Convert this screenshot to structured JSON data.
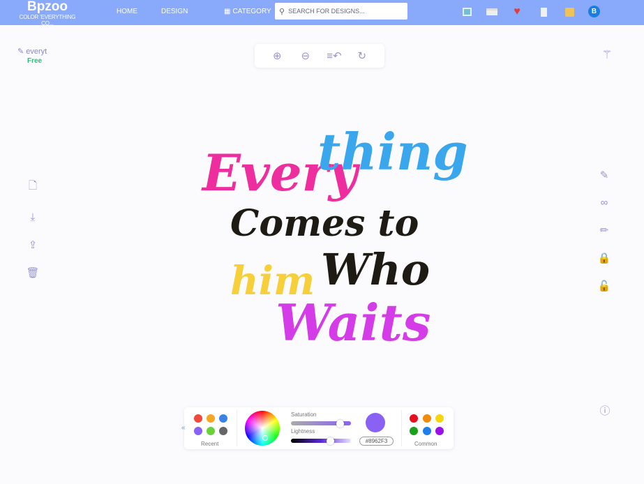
{
  "header": {
    "brand": "Bpzoo",
    "tagline": "COLOR 'EVERYTHING CO...",
    "nav": [
      "HOME",
      "DESIGN"
    ],
    "category": "CATEGORY",
    "search_placeholder": "SEARCH FOR DESIGNS...",
    "avatar": "B"
  },
  "design": {
    "title": "everyt",
    "price": "Free"
  },
  "artwork": {
    "lines": [
      "Every",
      "thing",
      "Comes to",
      "him",
      "Who",
      "Waits"
    ],
    "colors": [
      "#ee2e9f",
      "#3aa7ec",
      "#1e1a14",
      "#f6cf3b",
      "#1e1a14",
      "#d43ce8"
    ]
  },
  "palette": {
    "recent_label": "Recent",
    "common_label": "Common",
    "saturation_label": "Saturation",
    "lightness_label": "Lightness",
    "hex": "#8962F3",
    "saturation": 0.82,
    "lightness": 0.65,
    "recent": [
      "#f04a3a",
      "#f5a623",
      "#3b82e6",
      "#8962f3",
      "#6ad13b",
      "#666666"
    ],
    "common": [
      "#e8101f",
      "#f08c0a",
      "#f7d60e",
      "#1aa01d",
      "#1f7fe8",
      "#9b10e6"
    ]
  }
}
